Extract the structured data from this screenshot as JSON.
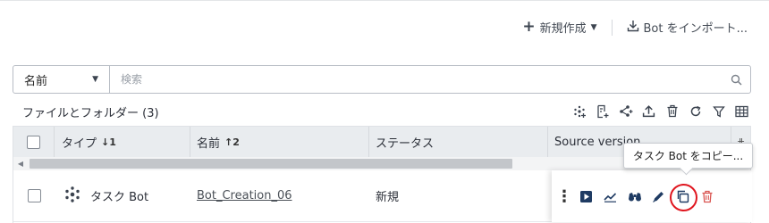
{
  "header": {
    "new_label": "新規作成",
    "import_label": "Bot をインポート..."
  },
  "search": {
    "field_selected": "名前",
    "placeholder": "検索"
  },
  "list": {
    "title": "ファイルとフォルダー (3)"
  },
  "toolbar": {
    "icons": [
      "add-bot-icon",
      "add-form-icon",
      "add-process-icon",
      "upload-icon",
      "delete-icon",
      "refresh-icon",
      "filter-icon",
      "columns-icon"
    ]
  },
  "table": {
    "columns": [
      {
        "label": "タイプ",
        "sort": "↓1"
      },
      {
        "label": "名前",
        "sort": "↑2"
      },
      {
        "label": "ステータス",
        "sort": ""
      },
      {
        "label": "Source version",
        "sort": ""
      }
    ],
    "rows": [
      {
        "type": "タスク Bot",
        "name": "Bot_Creation_06",
        "status": "新規"
      }
    ]
  },
  "tooltip": {
    "text": "タスク Bot をコピー..."
  },
  "colors": {
    "accent": "#1f3b63",
    "highlight_ring": "#e0161f",
    "delete_red": "#d9534f"
  }
}
